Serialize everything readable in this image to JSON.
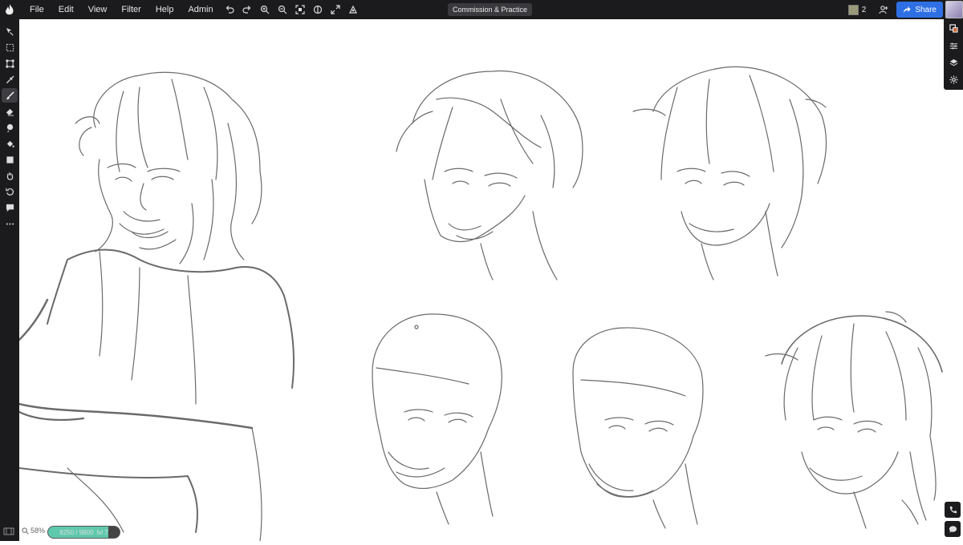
{
  "menu": {
    "items": [
      "File",
      "Edit",
      "View",
      "Filter",
      "Help",
      "Admin"
    ]
  },
  "document": {
    "title": "Commission & Practice"
  },
  "header": {
    "user_count": "2",
    "share_label": "Share"
  },
  "status": {
    "zoom": "58%",
    "xp_text": "8250 / 9800",
    "level_text": "lvl 7",
    "xp_fraction": 0.84
  },
  "colors": {
    "share": "#2f6fe4",
    "toolbar": "#1b1b1d",
    "xp_fill": "#5fc9ad"
  },
  "icons": {
    "toolbar": [
      "undo-icon",
      "redo-icon",
      "zoom-in-icon",
      "zoom-out-icon",
      "fit-screen-icon",
      "symmetry-icon",
      "fullscreen-icon",
      "reference-icon"
    ],
    "tools": [
      "move-icon",
      "select-icon",
      "transform-icon",
      "eyedropper-icon",
      "brush-icon",
      "eraser-icon",
      "smudge-icon",
      "fill-icon",
      "shape-icon",
      "hand-icon",
      "rotate-icon",
      "comment-icon",
      "more-icon"
    ],
    "panels": [
      "color-icon",
      "adjust-icon",
      "layers-icon",
      "settings-icon"
    ]
  }
}
